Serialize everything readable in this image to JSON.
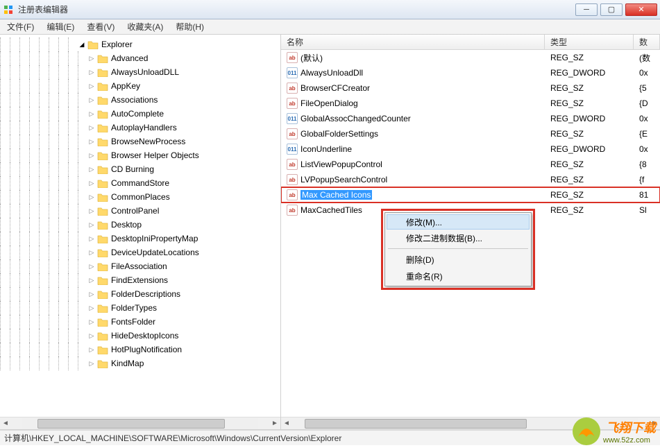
{
  "window": {
    "title": "注册表编辑器"
  },
  "menu": {
    "file": "文件(F)",
    "edit": "编辑(E)",
    "view": "查看(V)",
    "fav": "收藏夹(A)",
    "help": "帮助(H)"
  },
  "tree": {
    "root": "Explorer",
    "items": [
      "Advanced",
      "AlwaysUnloadDLL",
      "AppKey",
      "Associations",
      "AutoComplete",
      "AutoplayHandlers",
      "BrowseNewProcess",
      "Browser Helper Objects",
      "CD Burning",
      "CommandStore",
      "CommonPlaces",
      "ControlPanel",
      "Desktop",
      "DesktopIniPropertyMap",
      "DeviceUpdateLocations",
      "FileAssociation",
      "FindExtensions",
      "FolderDescriptions",
      "FolderTypes",
      "FontsFolder",
      "HideDesktopIcons",
      "HotPlugNotification",
      "KindMap"
    ]
  },
  "columns": {
    "name": "名称",
    "type": "类型",
    "data": "数"
  },
  "rows": [
    {
      "icon": "sz",
      "name": "(默认)",
      "type": "REG_SZ",
      "data": "(数"
    },
    {
      "icon": "dw",
      "name": "AlwaysUnloadDll",
      "type": "REG_DWORD",
      "data": "0x"
    },
    {
      "icon": "sz",
      "name": "BrowserCFCreator",
      "type": "REG_SZ",
      "data": "{5"
    },
    {
      "icon": "sz",
      "name": "FileOpenDialog",
      "type": "REG_SZ",
      "data": "{D"
    },
    {
      "icon": "dw",
      "name": "GlobalAssocChangedCounter",
      "type": "REG_DWORD",
      "data": "0x"
    },
    {
      "icon": "sz",
      "name": "GlobalFolderSettings",
      "type": "REG_SZ",
      "data": "{E"
    },
    {
      "icon": "dw",
      "name": "IconUnderline",
      "type": "REG_DWORD",
      "data": "0x"
    },
    {
      "icon": "sz",
      "name": "ListViewPopupControl",
      "type": "REG_SZ",
      "data": "{8"
    },
    {
      "icon": "sz",
      "name": "LVPopupSearchControl",
      "type": "REG_SZ",
      "data": "{f"
    },
    {
      "icon": "sz",
      "name": "Max Cached Icons",
      "type": "REG_SZ",
      "data": "81",
      "selected": true
    },
    {
      "icon": "sz",
      "name": "MaxCachedTiles",
      "type": "REG_SZ",
      "data": "Sl"
    }
  ],
  "context_menu": {
    "modify": "修改(M)...",
    "modify_binary": "修改二进制数据(B)...",
    "delete": "删除(D)",
    "rename": "重命名(R)"
  },
  "statusbar": {
    "path": "计算机\\HKEY_LOCAL_MACHINE\\SOFTWARE\\Microsoft\\Windows\\CurrentVersion\\Explorer"
  },
  "watermark": {
    "text": "飞翔下载",
    "url": "www.52z.com"
  }
}
